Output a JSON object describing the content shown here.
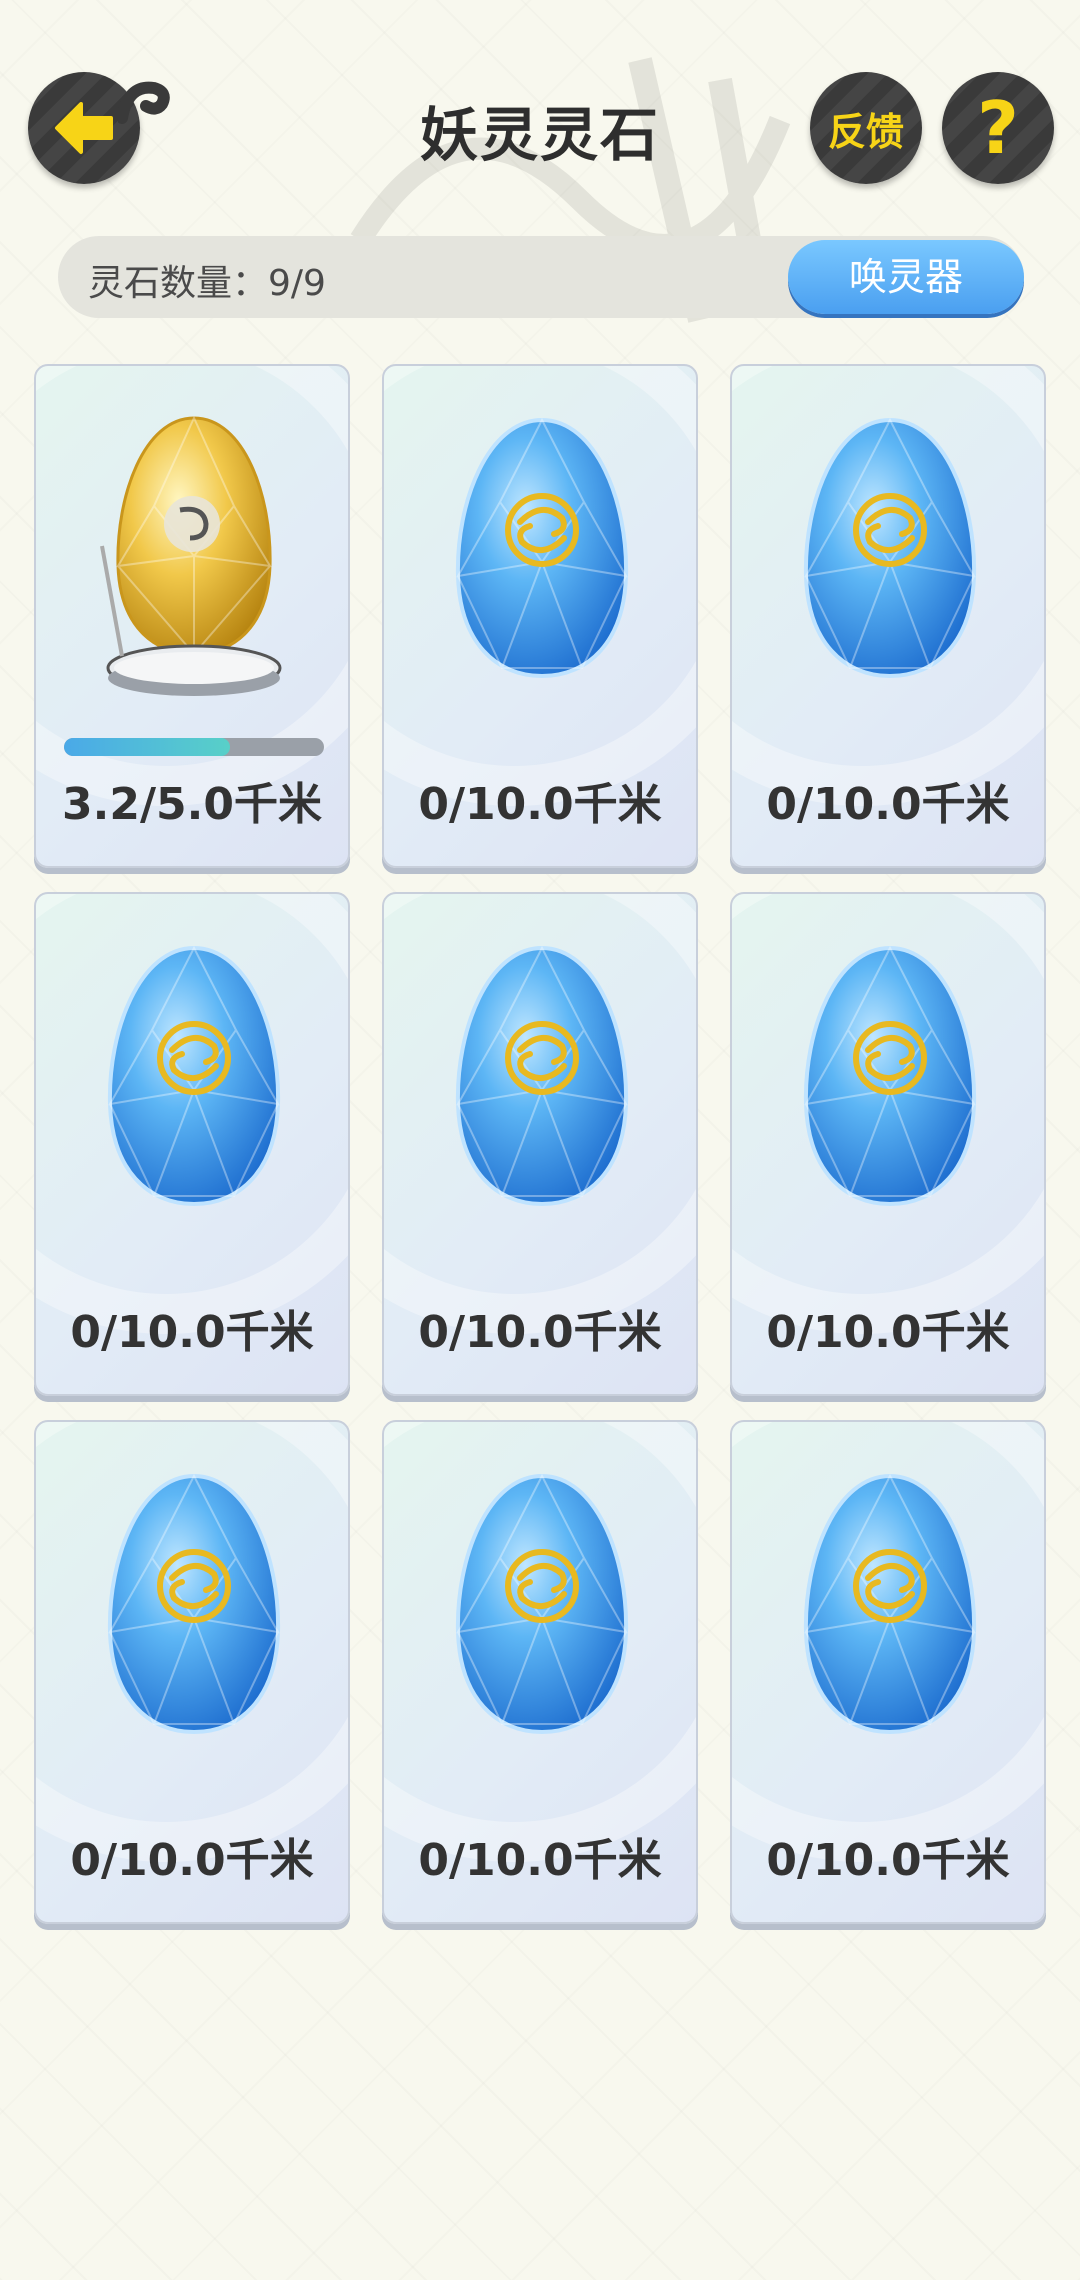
{
  "header": {
    "title": "妖灵灵石",
    "back_icon": "back-arrow-icon",
    "feedback_label": "反馈",
    "help_label": "?"
  },
  "stone_bar": {
    "count_text": "灵石数量：9/9",
    "summon_label": "唤灵器"
  },
  "colors": {
    "accent_yellow": "#f7d417",
    "button_blue": "#4a9ff0",
    "progress_start": "#4aa9e8",
    "progress_end": "#58d0c8"
  },
  "stones": [
    {
      "type": "gold-incubating",
      "distance": "3.2/5.0千米",
      "progress": 0.64
    },
    {
      "type": "blue",
      "distance": "0/10.0千米"
    },
    {
      "type": "blue",
      "distance": "0/10.0千米"
    },
    {
      "type": "blue",
      "distance": "0/10.0千米"
    },
    {
      "type": "blue",
      "distance": "0/10.0千米"
    },
    {
      "type": "blue",
      "distance": "0/10.0千米"
    },
    {
      "type": "blue",
      "distance": "0/10.0千米"
    },
    {
      "type": "blue",
      "distance": "0/10.0千米"
    },
    {
      "type": "blue",
      "distance": "0/10.0千米"
    }
  ]
}
